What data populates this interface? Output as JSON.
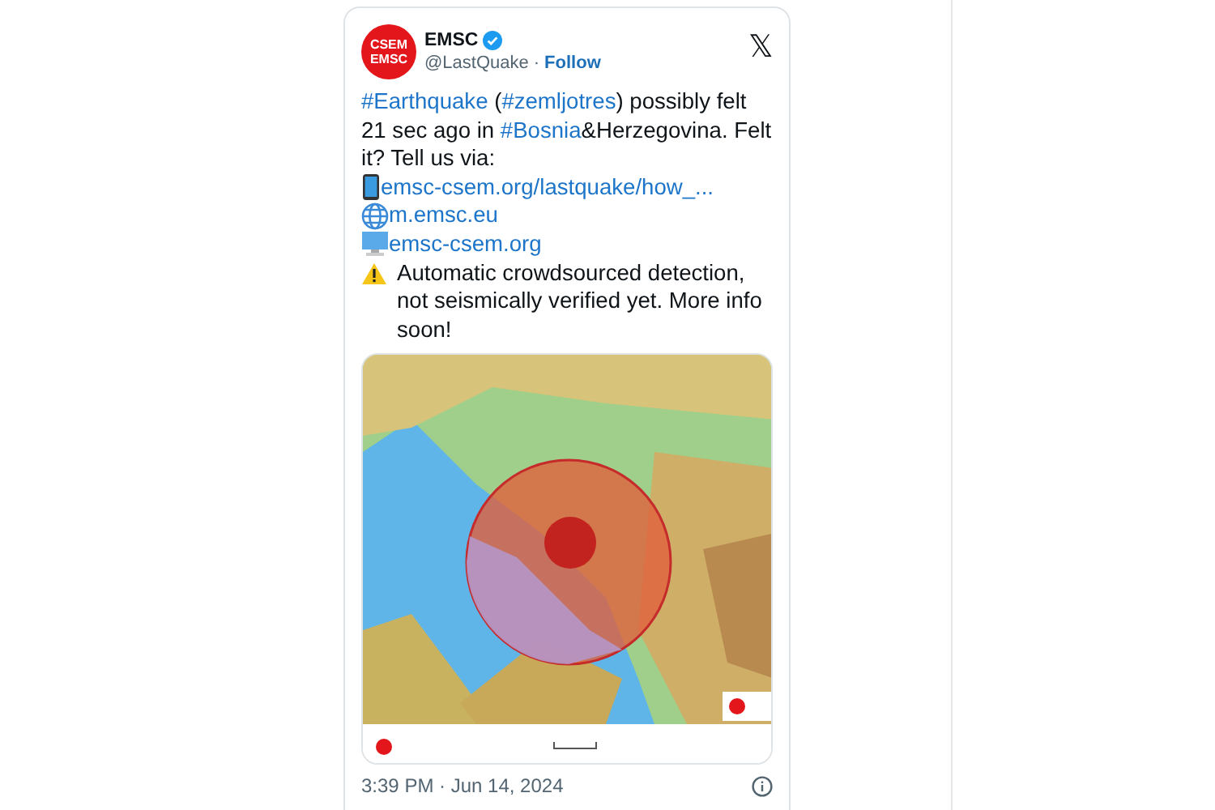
{
  "author": {
    "avatar_lines": [
      "CSEM",
      "EMSC"
    ],
    "name": "EMSC",
    "verified": true,
    "handle": "@LastQuake",
    "separator": "·",
    "follow": "Follow"
  },
  "close_glyph": "𝕏",
  "body": [
    {
      "kind": "text",
      "segments": [
        {
          "kind": "link",
          "text": "#Earthquake"
        },
        {
          "kind": "plain",
          "text": " ("
        },
        {
          "kind": "link",
          "text": "#zemljotres"
        },
        {
          "kind": "plain",
          "text": ") possibly felt 21 sec ago in "
        },
        {
          "kind": "link",
          "text": "#Bosnia"
        },
        {
          "kind": "plain",
          "text": "&Herzegovina. Felt it? Tell us via:"
        }
      ]
    },
    {
      "kind": "phone_link",
      "text": "emsc-csem.org/lastquake/how_..."
    },
    {
      "kind": "globe_link",
      "text": "m.emsc.eu"
    },
    {
      "kind": "computer_link",
      "text": "emsc-csem.org"
    },
    {
      "kind": "warning",
      "text": "Automatic crowdsourced detection, not seismically verified yet. More info soon!"
    }
  ],
  "timestamp": "3:39 PM · Jun 14, 2024"
}
